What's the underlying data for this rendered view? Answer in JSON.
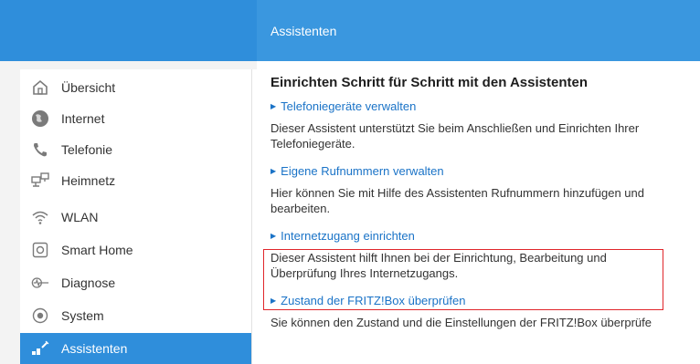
{
  "header": {
    "title": "Assistenten"
  },
  "sidebar": {
    "items": [
      {
        "label": "Übersicht",
        "icon": "home-icon"
      },
      {
        "label": "Internet",
        "icon": "globe-icon"
      },
      {
        "label": "Telefonie",
        "icon": "phone-icon"
      },
      {
        "label": "Heimnetz",
        "icon": "network-icon"
      },
      {
        "label": "WLAN",
        "icon": "wifi-icon"
      },
      {
        "label": "Smart Home",
        "icon": "smart-home-icon"
      },
      {
        "label": "Diagnose",
        "icon": "diagnose-icon"
      },
      {
        "label": "System",
        "icon": "system-icon"
      },
      {
        "label": "Assistenten",
        "icon": "wand-icon"
      }
    ],
    "active_index": 8
  },
  "main": {
    "heading": "Einrichten Schritt für Schritt mit den Assistenten",
    "sections": [
      {
        "link": "Telefoniegeräte verwalten",
        "desc_lines": [
          "Dieser Assistent unterstützt Sie beim Anschließen und Einrichten Ihrer",
          "Telefoniegeräte."
        ]
      },
      {
        "link": "Eigene Rufnummern verwalten",
        "desc_lines": [
          "Hier können Sie mit Hilfe des Assistenten Rufnummern hinzufügen und",
          "bearbeiten."
        ]
      },
      {
        "link": "Internetzugang einrichten",
        "desc_lines": [
          "Dieser Assistent hilft Ihnen bei der Einrichtung, Bearbeitung und",
          "Überprüfung Ihres Internetzugangs."
        ]
      },
      {
        "link": "Zustand der FRITZ!Box überprüfen",
        "desc_lines": [
          "Sie können den Zustand und die Einstellungen der FRITZ!Box überprüfe"
        ]
      }
    ]
  },
  "colors": {
    "header_blue": "#3a97df",
    "active_blue": "#2f8edb",
    "link_blue": "#1a73c7",
    "highlight_red": "#e0262b"
  }
}
